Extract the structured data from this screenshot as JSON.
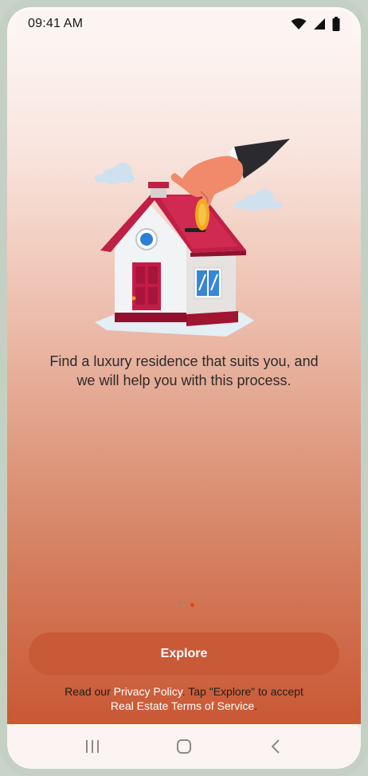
{
  "status_bar": {
    "time": "09:41 AM",
    "icons": [
      "wifi-icon",
      "cellular-signal-icon",
      "battery-icon"
    ]
  },
  "onboarding": {
    "tagline_line1": "Find a luxury residence that suits you, and",
    "tagline_line2": "we will help you with this process.",
    "page_indicator": {
      "total": 3,
      "active_index": 2
    }
  },
  "explore_button": {
    "label": "Explore"
  },
  "legal": {
    "prefix": "Read our ",
    "privacy_link": "Privacy Policy",
    "middle": ". Tap \"Explore\" to accept",
    "terms_link": "Real Estate Terms of Service",
    "suffix": "."
  },
  "nav_bar": {
    "buttons": [
      "recent-apps-icon",
      "home-icon",
      "back-icon"
    ]
  },
  "colors": {
    "accent": "#c85a38",
    "active_dot": "#e2451c",
    "link": "#ffffff"
  }
}
